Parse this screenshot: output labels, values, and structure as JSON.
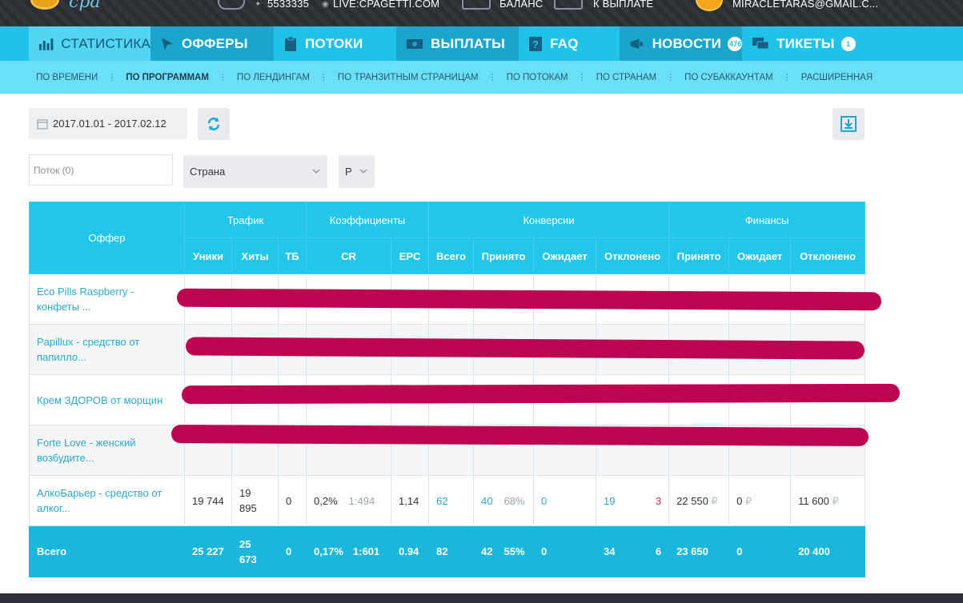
{
  "topbar": {
    "phone": "5533335",
    "live": "LIVE:CPAGETTI.COM",
    "balance_label": "БАЛАНС",
    "payout_label": "К ВЫПЛАТЕ",
    "user_email": "MIRACLETARAS@GMAIL.C..."
  },
  "nav": {
    "tabs": [
      {
        "label": "СТАТИСТИКА",
        "icon": "bar-chart-icon"
      },
      {
        "label": "ОФФЕРЫ",
        "icon": "cursor-icon"
      },
      {
        "label": "ПОТОКИ",
        "icon": "clipboard-icon"
      },
      {
        "label": "ВЫПЛАТЫ",
        "icon": "money-icon"
      },
      {
        "label": "FAQ",
        "icon": "question-icon"
      },
      {
        "label": "НОВОСТИ",
        "icon": "megaphone-icon",
        "badge": "476"
      },
      {
        "label": "ТИКЕТЫ",
        "icon": "chat-icon",
        "badge": "1"
      }
    ]
  },
  "subnav": {
    "items": [
      "ПО ВРЕМЕНИ",
      "ПО ПРОГРАММАМ",
      "ПО ЛЕНДИНГАМ",
      "ПО ТРАНЗИТНЫМ СТРАНИЦАМ",
      "ПО ПОТОКАМ",
      "ПО СТРАНАМ",
      "ПО СУБАККАУНТАМ",
      "РАСШИРЕННАЯ"
    ]
  },
  "filters": {
    "date_range": "2017.01.01 - 2017.02.12",
    "stream_placeholder": "Поток (0)",
    "country": "Страна",
    "currency": "Р"
  },
  "table": {
    "group_headers": {
      "offer": "Оффер",
      "traffic": "Трафик",
      "coef": "Коэффициенты",
      "conv": "Конверсии",
      "fin": "Финансы"
    },
    "sub_headers": [
      "Уники",
      "Хиты",
      "ТБ",
      "CR",
      "EPC",
      "Всего",
      "Принято",
      "Ожидает",
      "Отклонено",
      "Принято",
      "Ожидает",
      "Отклонено"
    ],
    "rows": [
      {
        "offer": "Eco Pills Raspberry - конфеты ..."
      },
      {
        "offer": "Papillux - средство от папилло..."
      },
      {
        "offer": "Крем ЗДОРОВ от морщин"
      },
      {
        "offer": "Forte Love - женский возбудите..."
      },
      {
        "offer": "АлкоБарьер - средство от алког...",
        "uniq": "19 744",
        "hits": "19 895",
        "tb": "0",
        "cr": "0,2%",
        "cr_ratio": "1:494",
        "epc": "1,14",
        "total": "62",
        "accepted": "40",
        "accepted_pct": "68%",
        "pending": "0",
        "rejected": "19",
        "rejected_extra": "3",
        "fin_accepted": "22 550",
        "fin_pending": "0",
        "fin_rejected": "11 600",
        "rub": "₽"
      }
    ],
    "total": {
      "label": "Всего",
      "uniq": "25 227",
      "hits": "25 673",
      "tb": "0",
      "cr": "0,17%",
      "cr_ratio": "1:601",
      "epc": "0.94",
      "total": "82",
      "accepted": "42",
      "accepted_pct": "55%",
      "pending": "0",
      "rejected": "34",
      "rejected_extra": "6",
      "fin_accepted": "23 650",
      "fin_pending": "0",
      "fin_rejected": "20 400"
    }
  },
  "colors": {
    "accent": "#1fc2e9",
    "active_tab": "#53d4f2",
    "subnav": "#6bdff7",
    "redaction": "#bc0650",
    "total_row": "#1ab6db"
  }
}
